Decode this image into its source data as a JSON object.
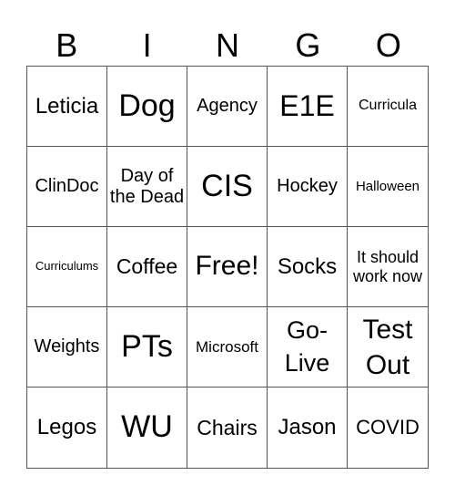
{
  "header": [
    "B",
    "I",
    "N",
    "G",
    "O"
  ],
  "cells": [
    "Leticia",
    "Dog",
    "Agency",
    "E1E",
    "Curricula",
    "ClinDoc",
    "Day of the Dead",
    "CIS",
    "Hockey",
    "Halloween",
    "Curriculums",
    "Coffee",
    "Free!",
    "Socks",
    "It should work now",
    "Weights",
    "PTs",
    "Microsoft",
    "Go-Live",
    "Test Out",
    "Legos",
    "WU",
    "Chairs",
    "Jason",
    "COVID"
  ]
}
